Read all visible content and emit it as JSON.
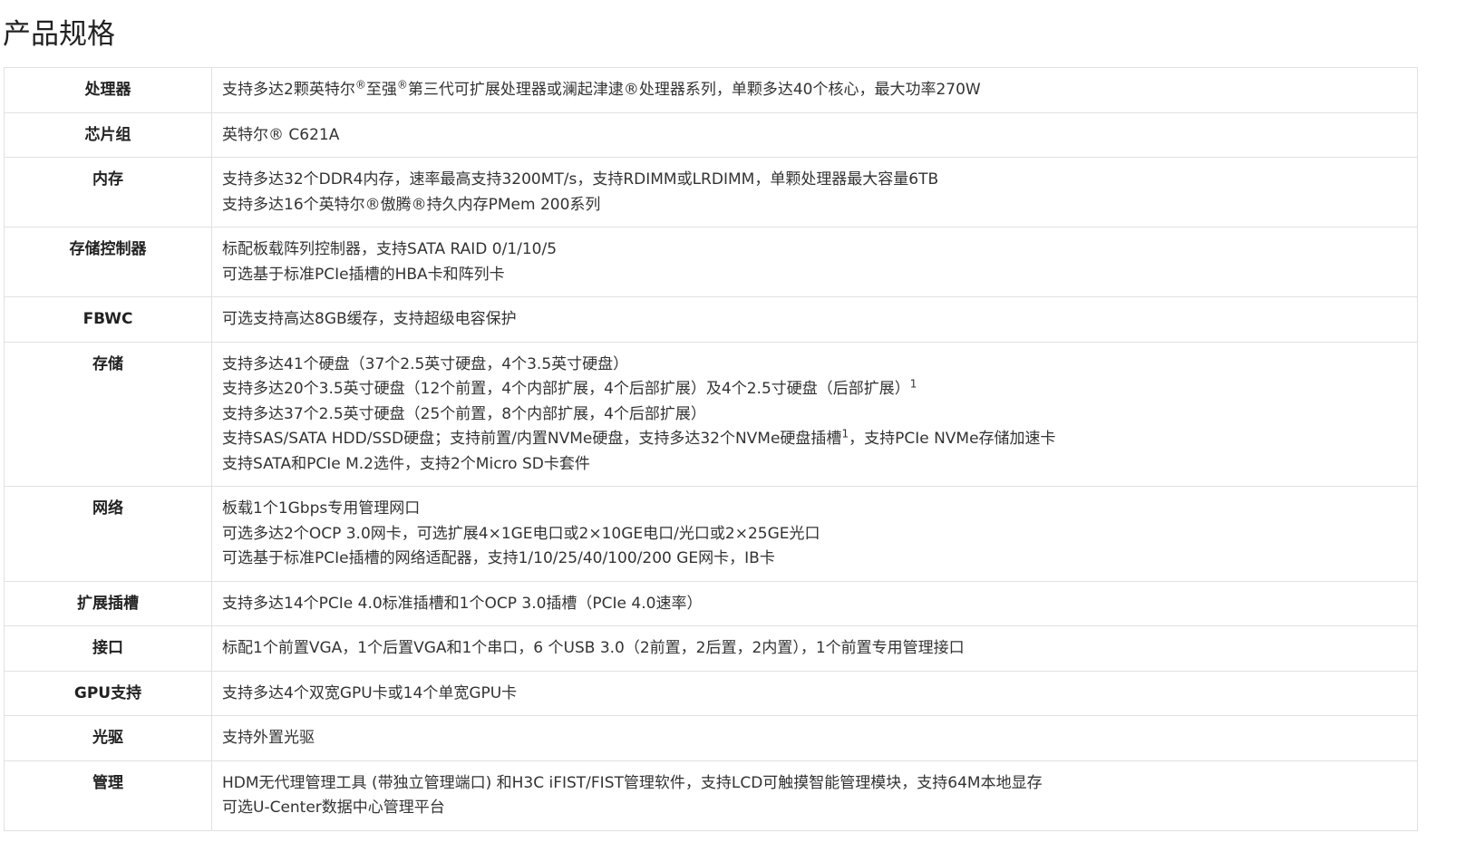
{
  "page": {
    "title": "产品规格"
  },
  "specs": [
    {
      "label": "处理器",
      "lines": [
        [
          "支持多达2颗英特尔",
          {
            "sup": "®"
          },
          "至强",
          {
            "sup": "®"
          },
          "第三代可扩展处理器或澜起津逮®处理器系列，单颗多达40个核心，最大功率270W"
        ]
      ]
    },
    {
      "label": "芯片组",
      "lines": [
        [
          "英特尔® C621A"
        ]
      ]
    },
    {
      "label": "内存",
      "lines": [
        [
          "支持多达32个DDR4内存，速率最高支持3200MT/s，支持RDIMM或LRDIMM，单颗处理器最大容量6TB"
        ],
        [
          "支持多达16个英特尔®傲腾®持久内存PMem 200系列"
        ]
      ]
    },
    {
      "label": "存储控制器",
      "lines": [
        [
          "标配板载阵列控制器，支持SATA RAID 0/1/10/5"
        ],
        [
          "可选基于标准PCIe插槽的HBA卡和阵列卡"
        ]
      ]
    },
    {
      "label": "FBWC",
      "lines": [
        [
          "可选支持高达8GB缓存，支持超级电容保护"
        ]
      ]
    },
    {
      "label": "存储",
      "lines": [
        [
          "支持多达41个硬盘（37个2.5英寸硬盘，4个3.5英寸硬盘）"
        ],
        [
          "支持多达20个3.5英寸硬盘（12个前置，4个内部扩展，4个后部扩展）及4个2.5寸硬盘（后部扩展）",
          {
            "sup": "1"
          }
        ],
        [
          "支持多达37个2.5英寸硬盘（25个前置，8个内部扩展，4个后部扩展）"
        ],
        [
          "支持SAS/SATA HDD/SSD硬盘；支持前置/内置NVMe硬盘，支持多达32个NVMe硬盘插槽",
          {
            "sup": "1"
          },
          "，支持PCIe NVMe存储加速卡"
        ],
        [
          "支持SATA和PCIe M.2选件，支持2个Micro SD卡套件"
        ]
      ]
    },
    {
      "label": "网络",
      "lines": [
        [
          "板载1个1Gbps专用管理网口"
        ],
        [
          "可选多达2个OCP 3.0网卡，可选扩展4×1GE电口或2×10GE电口/光口或2×25GE光口"
        ],
        [
          "可选基于标准PCIe插槽的网络适配器，支持1/10/25/40/100/200 GE网卡，IB卡"
        ]
      ]
    },
    {
      "label": "扩展插槽",
      "lines": [
        [
          "支持多达14个PCIe 4.0标准插槽和1个OCP 3.0插槽（PCIe 4.0速率）"
        ]
      ]
    },
    {
      "label": "接口",
      "lines": [
        [
          "标配1个前置VGA，1个后置VGA和1个串口，6 个USB 3.0（2前置，2后置，2内置），1个前置专用管理接口"
        ]
      ]
    },
    {
      "label": "GPU支持",
      "lines": [
        [
          "支持多达4个双宽GPU卡或14个单宽GPU卡"
        ]
      ]
    },
    {
      "label": "光驱",
      "lines": [
        [
          "支持外置光驱"
        ]
      ]
    },
    {
      "label": "管理",
      "lines": [
        [
          "HDM无代理管理工具 (带独立管理端口) 和H3C iFIST/FIST管理软件，支持LCD可触摸智能管理模块，支持64M本地显存"
        ],
        [
          "可选U-Center数据中心管理平台"
        ]
      ]
    }
  ]
}
